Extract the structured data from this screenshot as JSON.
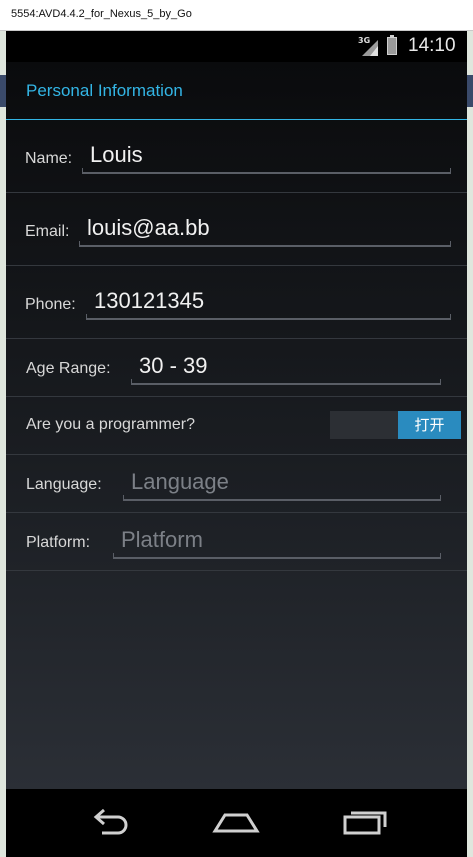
{
  "window": {
    "title": "5554:AVD4.4.2_for_Nexus_5_by_Go"
  },
  "status_bar": {
    "network": "3G",
    "time": "14:10"
  },
  "action_bar": {
    "title": "Personal Information"
  },
  "form": {
    "name": {
      "label": "Name:",
      "value": "Louis"
    },
    "email": {
      "label": "Email:",
      "value": "louis@aa.bb"
    },
    "phone": {
      "label": "Phone:",
      "value": "130121345"
    },
    "age_range": {
      "label": "Age Range:",
      "value": "30 - 39"
    },
    "programmer": {
      "label": "Are you a programmer?",
      "toggle_text": "打开",
      "on": true
    },
    "language": {
      "label": "Language:",
      "placeholder": "Language"
    },
    "platform": {
      "label": "Platform:",
      "placeholder": "Platform"
    }
  },
  "nav_bar": {
    "icons": [
      "back-icon",
      "home-icon",
      "recent-apps-icon"
    ]
  },
  "colors": {
    "accent": "#33b5e5",
    "toggle_on": "#2a8bbf"
  }
}
